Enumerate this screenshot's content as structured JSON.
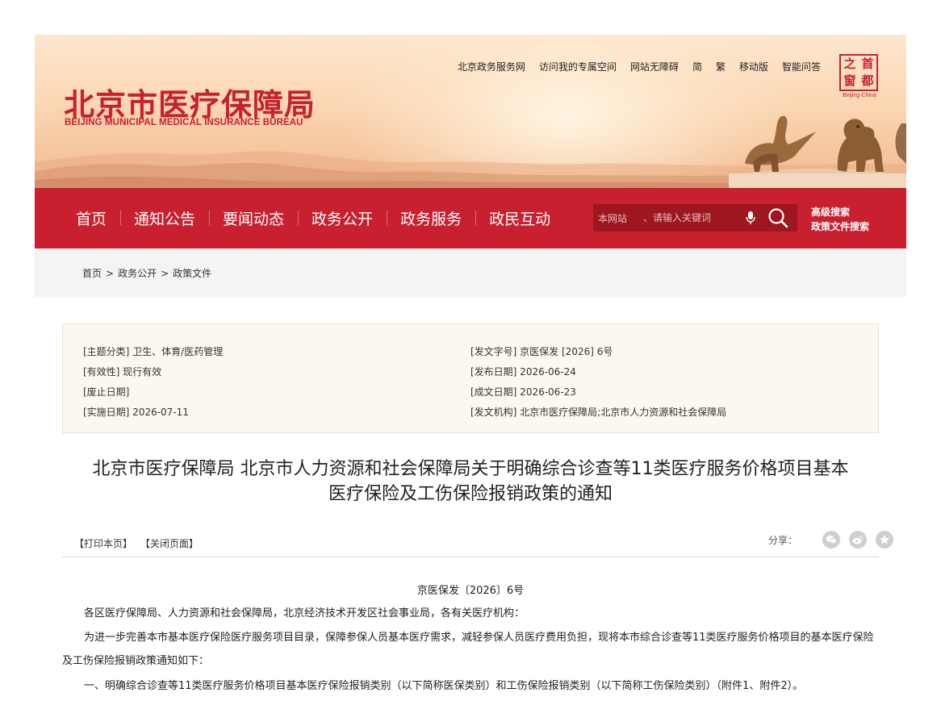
{
  "header": {
    "logo_cn": "北京市医疗保障局",
    "logo_en": "BEIJING MUNICIPAL MEDICAL INSURANCE BUREAU",
    "top_links": [
      "北京政务服务网",
      "访问我的专属空间",
      "网站无障碍",
      "简",
      "繁",
      "移动版",
      "智能问答"
    ],
    "capital_logo": {
      "chars": [
        "之",
        "首",
        "窗",
        "都"
      ],
      "en": "Beijing-China"
    }
  },
  "nav": {
    "items": [
      "首页",
      "通知公告",
      "要闻动态",
      "政务公开",
      "政务服务",
      "政民互动"
    ],
    "search_scope": "本网站",
    "search_placeholder": "、请输入关键词",
    "advanced_search": "高级搜索",
    "policy_search": "政策文件搜索"
  },
  "breadcrumb": {
    "home": "首页",
    "level2": "政务公开",
    "level3": "政策文件",
    "sep": ">"
  },
  "meta": {
    "left": [
      "[主题分类] 卫生、体育/医药管理",
      "[有效性] 现行有效",
      "[废止日期]",
      "[实施日期] 2026-07-11"
    ],
    "right": [
      "[发文字号] 京医保发 [2026] 6号",
      "[发布日期] 2026-06-24",
      "[成文日期] 2026-06-23",
      "[发文机构] 北京市医疗保障局;北京市人力资源和社会保障局"
    ]
  },
  "document": {
    "title_line1": "北京市医疗保障局 北京市人力资源和社会保障局关于明确综合诊查等11类医疗服务价格项目基本",
    "title_line2": "医疗保险及工伤保险报销政策的通知",
    "number": "京医保发〔2026〕6号",
    "addressee": "各区医疗保障局、人力资源和社会保障局，北京经济技术开发区社会事业局，各有关医疗机构：",
    "intro": "为进一步完善本市基本医疗保险医疗服务项目目录，保障参保人员基本医疗需求，减轻参保人员医疗费用负担，现将本市综合诊查等11类医疗服务价格项目的基本医疗保险及工伤保险报销政策通知如下：",
    "item1": "一、明确综合诊查等11类医疗服务价格项目基本医疗保险报销类别（以下简称医保类别）和工伤保险报销类别（以下简称工伤保险类别）（附件1、附件2）。"
  },
  "tools": {
    "print": "【打印本页】",
    "close": "【关闭页面】",
    "share_label": "分享："
  },
  "share_icons": [
    "wechat-icon",
    "weibo-icon",
    "favorite-icon"
  ],
  "colors": {
    "brand_red": "#c8202f",
    "search_bg": "#9d1620",
    "meta_bg": "#fdf8ef"
  }
}
